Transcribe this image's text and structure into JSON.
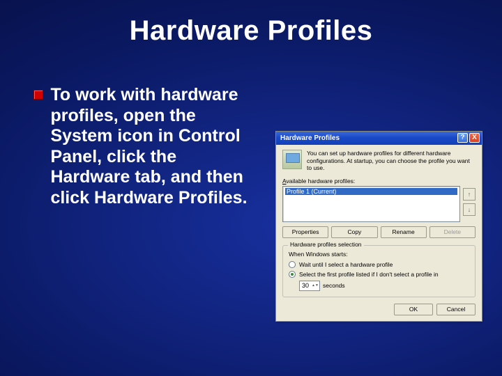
{
  "slide": {
    "title": "Hardware Profiles",
    "bullet": "To work with hardware profiles, open the System icon in Control Panel, click the Hardware tab, and then click Hardware Profiles."
  },
  "dialog": {
    "title": "Hardware Profiles",
    "help_btn": "?",
    "close_btn": "X",
    "intro": "You can set up hardware profiles for different hardware configurations. At startup, you can choose the profile you want to use.",
    "available_label": "Available hardware profiles:",
    "profiles": [
      "Profile 1 (Current)"
    ],
    "arrow_up": "↑",
    "arrow_down": "↓",
    "buttons": {
      "properties": "Properties",
      "copy": "Copy",
      "rename": "Rename",
      "delete": "Delete"
    },
    "group_title": "Hardware profiles selection",
    "group_sub": "When Windows starts:",
    "radio_wait": "Wait until I select a hardware profile",
    "radio_select_pre": "Select the first profile listed if I don't select a profile in",
    "seconds_value": "30",
    "seconds_label": "seconds",
    "ok": "OK",
    "cancel": "Cancel"
  }
}
